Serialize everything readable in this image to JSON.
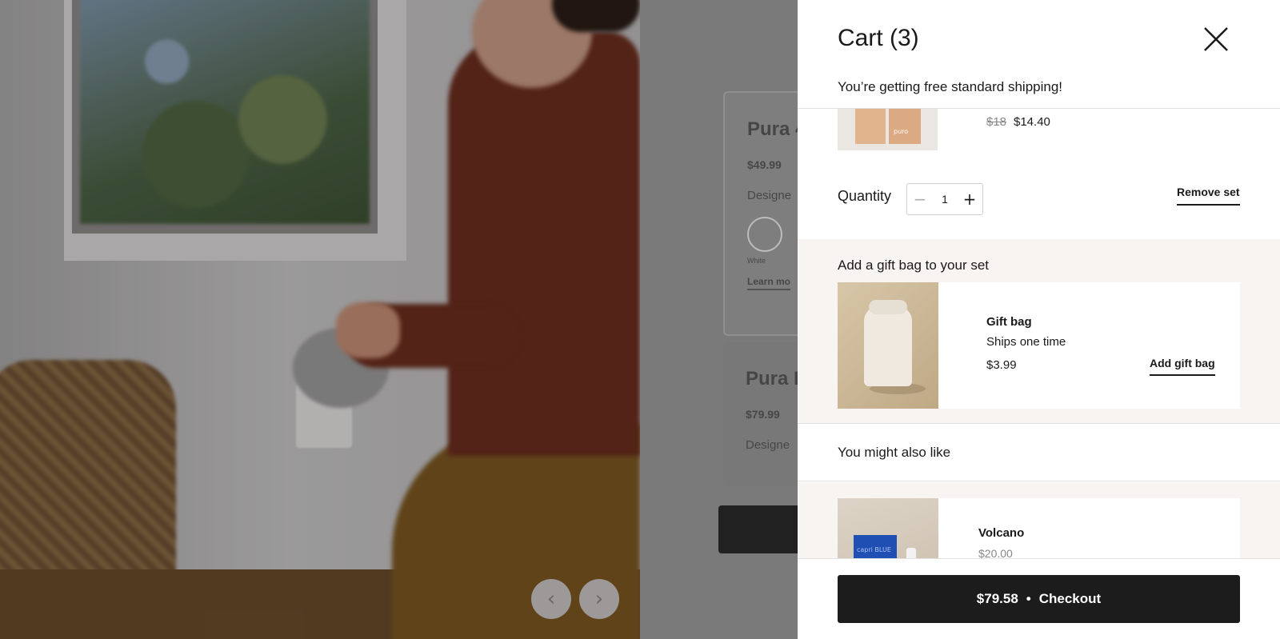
{
  "background": {
    "carousel_prev_icon": "chevron-left-icon",
    "carousel_next_icon": "chevron-right-icon",
    "products": [
      {
        "name": "Pura 4",
        "price": "$49.99",
        "desc": "Designe",
        "swatch": "White",
        "link": "Learn mo"
      },
      {
        "name": "Pura P",
        "price": "$79.99",
        "desc": "Designe"
      }
    ]
  },
  "cart": {
    "title": "Cart (3)",
    "close_icon": "close-icon",
    "shipping_message": "You’re getting free standard shipping!",
    "item": {
      "thumb_label": "puro",
      "price_original": "$18",
      "price_current": "$14.40",
      "quantity_label": "Quantity",
      "quantity": "1",
      "minus_icon": "minus-icon",
      "plus_icon": "plus-icon",
      "remove_label": "Remove set"
    },
    "gift": {
      "heading": "Add a gift bag to your set",
      "name": "Gift bag",
      "shipping": "Ships one time",
      "price": "$3.99",
      "add_label": "Add gift bag"
    },
    "recommendations": {
      "heading": "You might also like",
      "items": [
        {
          "name": "Volcano",
          "price": "$20.00",
          "box_label": "capri BLUE"
        }
      ]
    },
    "checkout": {
      "total": "$79.58",
      "separator": "•",
      "label": "Checkout"
    }
  },
  "colors": {
    "checkout_bg": "#1c1c1c",
    "gift_section_bg": "#f8f4f1"
  }
}
